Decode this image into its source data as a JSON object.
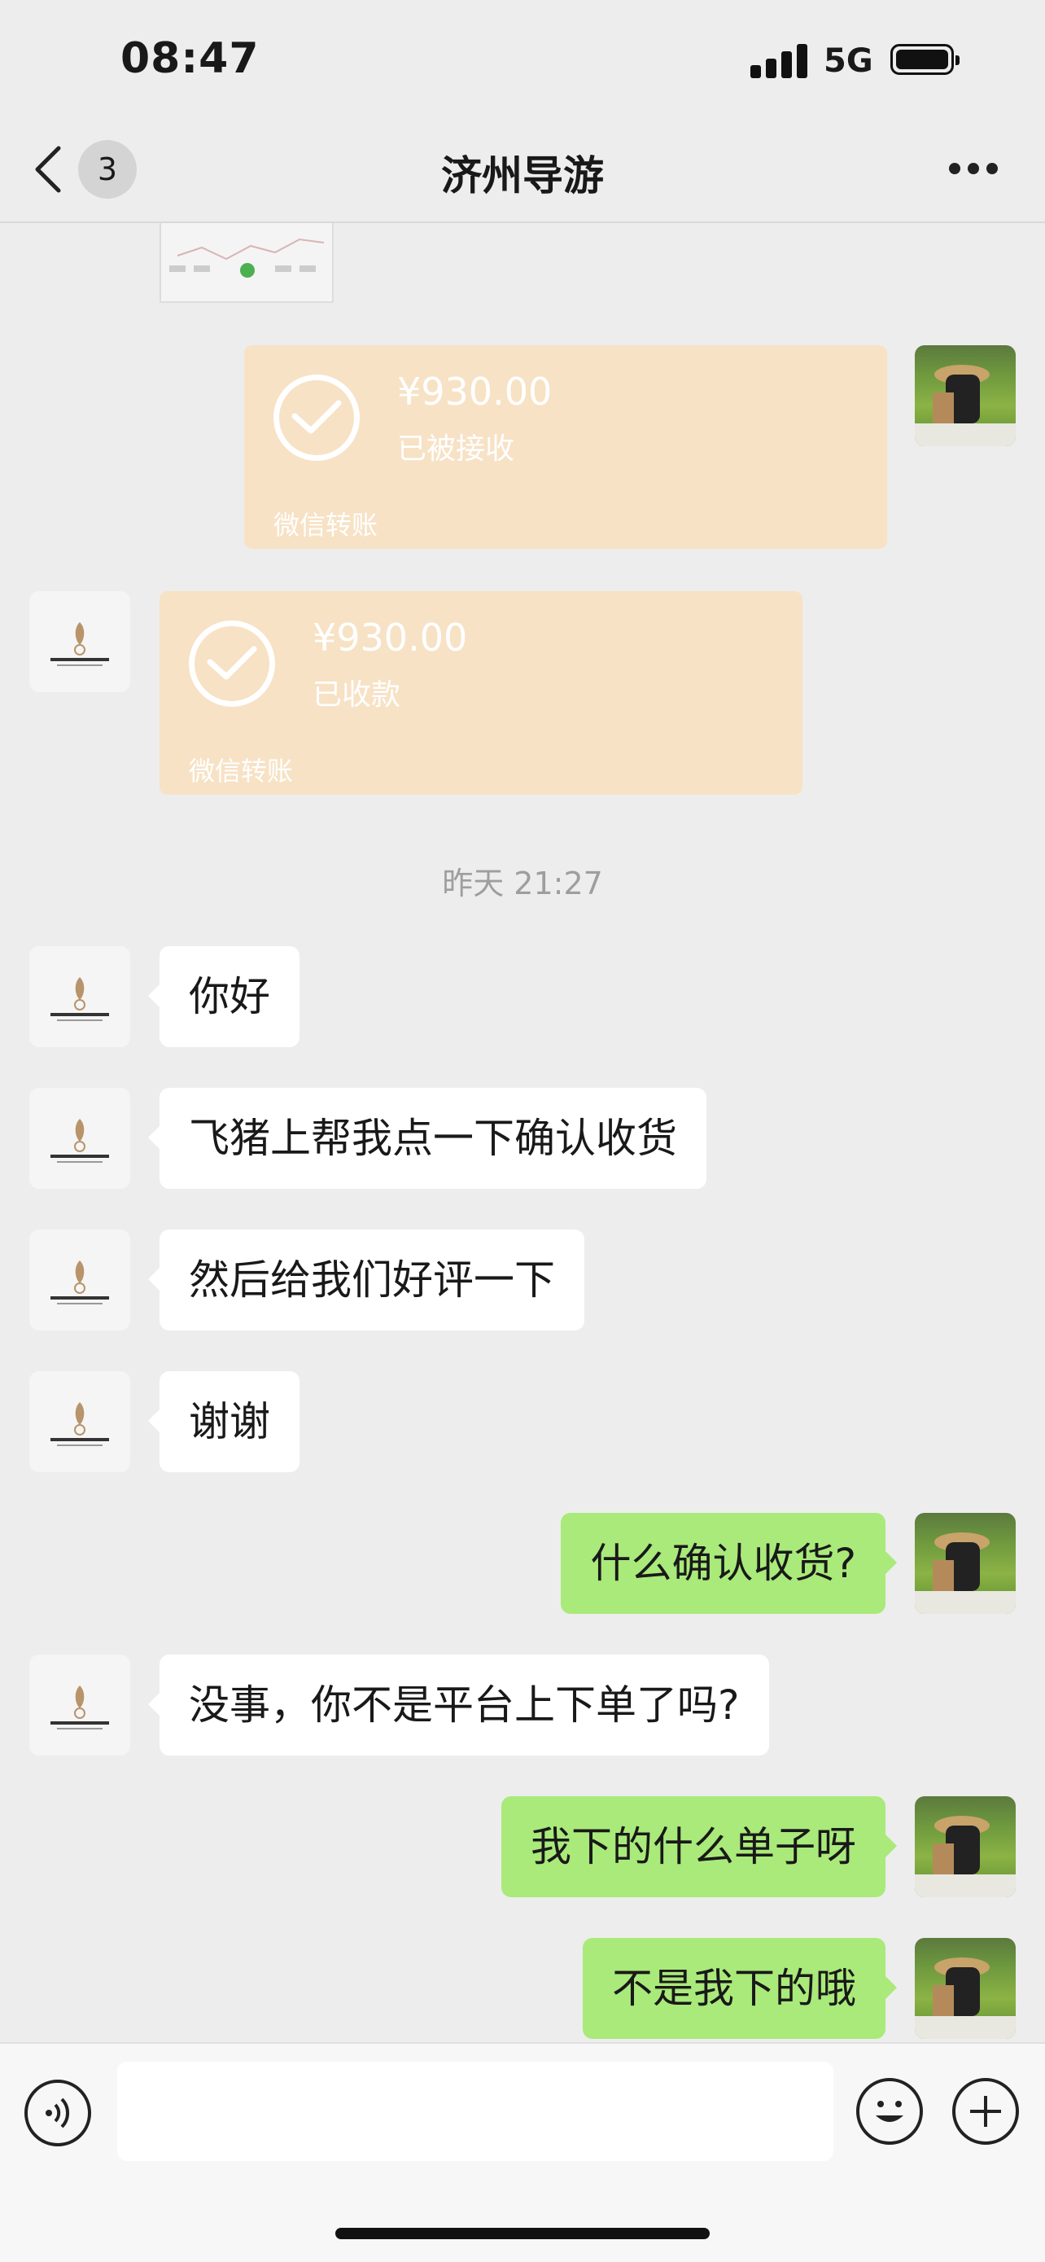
{
  "status_bar": {
    "time": "08:47",
    "network": "5G"
  },
  "nav": {
    "unread_count": "3",
    "title": "济州导游",
    "back_icon": "chevron-left-icon",
    "more_icon": "ellipsis-icon"
  },
  "messages": [
    {
      "type": "image",
      "direction": "in"
    },
    {
      "type": "transfer",
      "direction": "out",
      "amount": "¥930.00",
      "status": "已被接收",
      "label": "微信转账"
    },
    {
      "type": "transfer",
      "direction": "in",
      "amount": "¥930.00",
      "status": "已收款",
      "label": "微信转账"
    },
    {
      "type": "timestamp",
      "text": "昨天 21:27"
    },
    {
      "type": "text",
      "direction": "in",
      "text": "你好"
    },
    {
      "type": "text",
      "direction": "in",
      "text": "飞猪上帮我点一下确认收货"
    },
    {
      "type": "text",
      "direction": "in",
      "text": "然后给我们好评一下"
    },
    {
      "type": "text",
      "direction": "in",
      "text": "谢谢"
    },
    {
      "type": "text",
      "direction": "out",
      "text": "什么确认收货?"
    },
    {
      "type": "text",
      "direction": "in",
      "text": "没事，你不是平台上下单了吗?"
    },
    {
      "type": "text",
      "direction": "out",
      "text": "我下的什么单子呀"
    },
    {
      "type": "text",
      "direction": "out",
      "text": "不是我下的哦"
    }
  ],
  "input_bar": {
    "message_value": "",
    "voice_icon": "voice-icon",
    "emoji_icon": "emoji-icon",
    "plus_icon": "plus-icon"
  },
  "colors": {
    "background": "#ededed",
    "incoming_bubble": "#ffffff",
    "outgoing_bubble": "#a9ea7a",
    "transfer_card": "#f7e2c5"
  }
}
